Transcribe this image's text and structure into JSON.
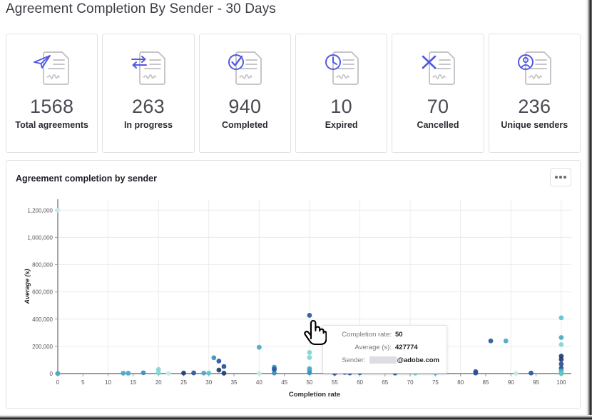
{
  "page": {
    "title": "Agreement Completion By Sender - 30 Days"
  },
  "kpi_cards": [
    {
      "value": "1568",
      "label": "Total agreements",
      "icon": "paper-plane-document-icon"
    },
    {
      "value": "263",
      "label": "In progress",
      "icon": "exchange-arrows-document-icon"
    },
    {
      "value": "940",
      "label": "Completed",
      "icon": "check-circle-document-icon"
    },
    {
      "value": "10",
      "label": "Expired",
      "icon": "clock-document-icon"
    },
    {
      "value": "70",
      "label": "Cancelled",
      "icon": "x-cross-document-icon"
    },
    {
      "value": "236",
      "label": "Unique senders",
      "icon": "user-circle-document-icon"
    }
  ],
  "chart_panel": {
    "title": "Agreement completion by sender",
    "more_button_label": "•••"
  },
  "tooltip": {
    "rows": [
      {
        "key": "Completion rate:",
        "value": "50"
      },
      {
        "key": "Average (s):",
        "value": "427774"
      }
    ],
    "sender_key": "Sender:",
    "sender_domain": "@adobe.com",
    "sender_redacted": true
  },
  "colors": {
    "accent": "#5258e4",
    "icon_outline": "#bdbdc4",
    "card_border": "#e2e2e2",
    "title_text": "#3c3c44",
    "value_text": "#4a4a52",
    "grid": "#ececec",
    "axis": "#9a9aa0",
    "point_dark": "#1f3c70",
    "point_mid": "#3c77b5",
    "point_light": "#7fd6d2",
    "point_pale": "#c6ece9"
  },
  "chart_data": {
    "type": "scatter",
    "title": "Agreement completion by sender",
    "xlabel": "Completion rate",
    "ylabel": "Average (s)",
    "xlim": [
      0,
      102
    ],
    "ylim": [
      0,
      1280000
    ],
    "xticks": [
      0,
      5,
      10,
      15,
      20,
      25,
      30,
      35,
      40,
      45,
      50,
      55,
      60,
      65,
      70,
      75,
      80,
      85,
      90,
      95,
      100
    ],
    "yticks": [
      0,
      200000,
      400000,
      600000,
      800000,
      1000000,
      1200000
    ],
    "ytick_labels": [
      "0",
      "200,000",
      "400,000",
      "600,000",
      "800,000",
      "1,000,000",
      "1,200,000"
    ],
    "grid": true,
    "legend": "none",
    "highlighted_point": {
      "x": 50,
      "y": 427774
    },
    "points": [
      {
        "x": 0,
        "y": 1200000,
        "c": "#c6ece9"
      },
      {
        "x": 0,
        "y": 2000,
        "c": "#7fd6d2"
      },
      {
        "x": 0,
        "y": 0,
        "c": "#4aa8c4"
      },
      {
        "x": 13,
        "y": 3000,
        "c": "#4aa8c4"
      },
      {
        "x": 14,
        "y": 3000,
        "c": "#4aa8c4"
      },
      {
        "x": 17,
        "y": 6000,
        "c": "#3c8fc0"
      },
      {
        "x": 20,
        "y": 30000,
        "c": "#7fd6d2"
      },
      {
        "x": 20,
        "y": 5000,
        "c": "#7fd6d2"
      },
      {
        "x": 22,
        "y": 2000,
        "c": "#c6ece9"
      },
      {
        "x": 25,
        "y": 4000,
        "c": "#1f3c70"
      },
      {
        "x": 27,
        "y": 5000,
        "c": "#2d57a0"
      },
      {
        "x": 29,
        "y": 4000,
        "c": "#4aa8c4"
      },
      {
        "x": 30,
        "y": 4000,
        "c": "#5bc4cd"
      },
      {
        "x": 31,
        "y": 116000,
        "c": "#3c8fc0"
      },
      {
        "x": 32,
        "y": 92000,
        "c": "#2d57a0"
      },
      {
        "x": 32,
        "y": 26000,
        "c": "#1f3c70"
      },
      {
        "x": 33,
        "y": 3000,
        "c": "#1f3c70"
      },
      {
        "x": 33,
        "y": 52000,
        "c": "#2a4f95"
      },
      {
        "x": 40,
        "y": 2000,
        "c": "#c6ece9"
      },
      {
        "x": 40,
        "y": 193000,
        "c": "#4aa8c4"
      },
      {
        "x": 43,
        "y": 4000,
        "c": "#3c8fc0"
      },
      {
        "x": 43,
        "y": 47000,
        "c": "#3c8fc0"
      },
      {
        "x": 43,
        "y": 38000,
        "c": "#3c8fc0"
      },
      {
        "x": 43,
        "y": 30000,
        "c": "#2d57a0"
      },
      {
        "x": 50,
        "y": 427774,
        "c": "#2d57a0"
      },
      {
        "x": 50,
        "y": 155000,
        "c": "#7fd6d2"
      },
      {
        "x": 50,
        "y": 118000,
        "c": "#7fd6d2"
      },
      {
        "x": 50,
        "y": 36000,
        "c": "#4aa8c4"
      },
      {
        "x": 50,
        "y": 22000,
        "c": "#4aa8c4"
      },
      {
        "x": 50,
        "y": 6000,
        "c": "#3c8fc0"
      },
      {
        "x": 55,
        "y": 3000,
        "c": "#2d57a0"
      },
      {
        "x": 57,
        "y": 9000,
        "c": "#2d57a0"
      },
      {
        "x": 58,
        "y": 5000,
        "c": "#2d57a0"
      },
      {
        "x": 60,
        "y": 7000,
        "c": "#2d57a0"
      },
      {
        "x": 67,
        "y": 4000,
        "c": "#2d57a0"
      },
      {
        "x": 71,
        "y": 5000,
        "c": "#5bc4cd"
      },
      {
        "x": 75,
        "y": 4000,
        "c": "#5bc4cd"
      },
      {
        "x": 83,
        "y": 14000,
        "c": "#2a4f95"
      },
      {
        "x": 83,
        "y": 4000,
        "c": "#2a4f95"
      },
      {
        "x": 86,
        "y": 240000,
        "c": "#2d57a0"
      },
      {
        "x": 89,
        "y": 240000,
        "c": "#4aa8c4"
      },
      {
        "x": 91,
        "y": 2000,
        "c": "#c6ece9"
      },
      {
        "x": 94,
        "y": 4000,
        "c": "#2d57a0"
      },
      {
        "x": 100,
        "y": 410000,
        "c": "#5bc4cd"
      },
      {
        "x": 100,
        "y": 265000,
        "c": "#4aa8c4"
      },
      {
        "x": 100,
        "y": 213000,
        "c": "#7fd6d2"
      },
      {
        "x": 100,
        "y": 128000,
        "c": "#1f3c70"
      },
      {
        "x": 100,
        "y": 104000,
        "c": "#1f3c70"
      },
      {
        "x": 100,
        "y": 70000,
        "c": "#2a4f95"
      },
      {
        "x": 100,
        "y": 40000,
        "c": "#2a4f95"
      },
      {
        "x": 100,
        "y": 20000,
        "c": "#4aa8c4"
      },
      {
        "x": 100,
        "y": 6000,
        "c": "#5bc4cd"
      },
      {
        "x": 100,
        "y": 0,
        "c": "#5bc4cd"
      }
    ]
  }
}
